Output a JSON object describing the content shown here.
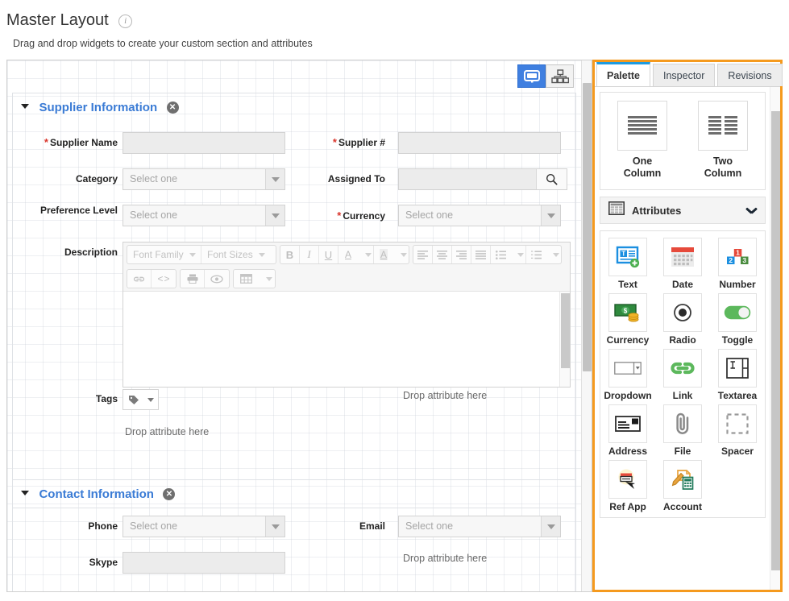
{
  "header": {
    "title": "Master Layout",
    "info_icon": "info-icon",
    "subtitle": "Drag and drop widgets to create your custom section and attributes"
  },
  "canvas": {
    "view_toggle": [
      {
        "name": "desktop-view",
        "icon": "monitor-icon",
        "active": true
      },
      {
        "name": "tree-view",
        "icon": "hierarchy-icon",
        "active": false
      }
    ],
    "sections": [
      {
        "title": "Supplier Information",
        "close_label": "✕",
        "fields": [
          {
            "label": "Supplier Name",
            "required": true,
            "type": "text"
          },
          {
            "label": "Supplier #",
            "required": true,
            "type": "text"
          },
          {
            "label": "Category",
            "required": false,
            "type": "select",
            "placeholder": "Select one"
          },
          {
            "label": "Assigned To",
            "required": false,
            "type": "search"
          },
          {
            "label": "Preference Level",
            "required": false,
            "type": "select",
            "placeholder": "Select one"
          },
          {
            "label": "Currency",
            "required": true,
            "type": "select",
            "placeholder": "Select one"
          },
          {
            "label": "Description",
            "required": false,
            "type": "richtext"
          },
          {
            "label": "Tags",
            "required": false,
            "type": "tag"
          }
        ],
        "drop_hints": [
          "Drop attribute here",
          "Drop attribute here"
        ]
      },
      {
        "title": "Contact Information",
        "close_label": "✕",
        "fields": [
          {
            "label": "Phone",
            "required": false,
            "type": "select",
            "placeholder": "Select one"
          },
          {
            "label": "Email",
            "required": false,
            "type": "select",
            "placeholder": "Select one"
          },
          {
            "label": "Skype",
            "required": false,
            "type": "text"
          }
        ],
        "drop_hints": [
          "Drop attribute here"
        ]
      }
    ],
    "editor_toolbar": {
      "font_family": "Font Family",
      "font_sizes": "Font Sizes",
      "buttons_row1": [
        "B",
        "I",
        "U",
        "A",
        "A"
      ],
      "align_buttons": [
        "align-left",
        "align-center",
        "align-right",
        "align-justify",
        "bullet-list",
        "numbered-list"
      ],
      "buttons_row2": [
        "link",
        "source-code",
        "print",
        "preview",
        "table"
      ]
    },
    "tag_icon": "tag-icon"
  },
  "palette": {
    "accent_color": "#f59a1e",
    "active_tab_color": "#1f9be0",
    "tabs": [
      {
        "label": "Palette",
        "active": true
      },
      {
        "label": "Inspector",
        "active": false
      },
      {
        "label": "Revisions",
        "active": false
      }
    ],
    "layouts": [
      {
        "label": "One Column",
        "icon": "one-column-icon"
      },
      {
        "label": "Two Column",
        "icon": "two-column-icon"
      }
    ],
    "attributes_header": {
      "label": "Attributes",
      "icon": "grid-icon",
      "chevron": "chevron-down-icon"
    },
    "attributes": [
      {
        "label": "Text",
        "icon": "text-icon"
      },
      {
        "label": "Date",
        "icon": "calendar-icon"
      },
      {
        "label": "Number",
        "icon": "number-icon"
      },
      {
        "label": "Currency",
        "icon": "currency-icon"
      },
      {
        "label": "Radio",
        "icon": "radio-icon"
      },
      {
        "label": "Toggle",
        "icon": "toggle-icon"
      },
      {
        "label": "Dropdown",
        "icon": "dropdown-icon"
      },
      {
        "label": "Link",
        "icon": "link-icon"
      },
      {
        "label": "Textarea",
        "icon": "textarea-icon"
      },
      {
        "label": "Address",
        "icon": "address-icon"
      },
      {
        "label": "File",
        "icon": "paperclip-icon"
      },
      {
        "label": "Spacer",
        "icon": "spacer-icon"
      },
      {
        "label": "Ref App",
        "icon": "ref-app-icon"
      },
      {
        "label": "Account",
        "icon": "account-icon"
      }
    ]
  }
}
